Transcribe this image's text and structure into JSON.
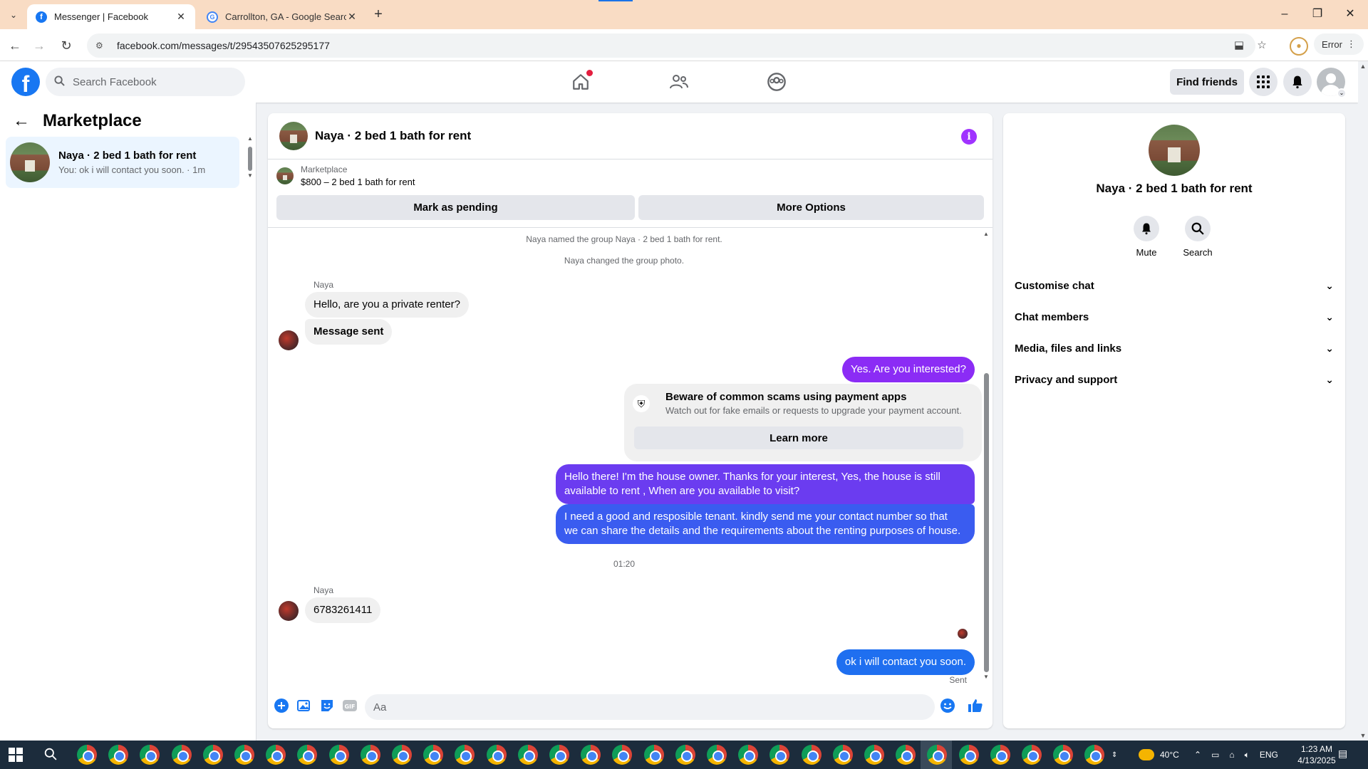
{
  "browser": {
    "tabs": [
      {
        "title": "Messenger | Facebook",
        "active": true
      },
      {
        "title": "Carrollton, GA - Google Search",
        "active": false
      }
    ],
    "url": "facebook.com/messages/t/29543507625295177",
    "error_label": "Error"
  },
  "fb": {
    "search_placeholder": "Search Facebook",
    "find_friends": "Find friends"
  },
  "sidebar": {
    "title": "Marketplace",
    "conversations": [
      {
        "name": "Naya · 2 bed 1 bath for rent",
        "preview": "You: ok i will contact you soon. · 1m"
      }
    ]
  },
  "chat": {
    "title": "Naya · 2 bed 1 bath for rent",
    "marketplace_label": "Marketplace",
    "listing": "$800 – 2 bed 1 bath for rent",
    "btn_pending": "Mark as pending",
    "btn_more": "More Options",
    "system_messages": [
      "Naya named the group Naya · 2 bed 1 bath for rent.",
      "Naya changed the group photo."
    ],
    "sender": "Naya",
    "msg_in_1": "Hello, are you a private renter?",
    "msg_in_2": "Message sent",
    "msg_out_1": "Yes. Are you interested?",
    "scam_title": "Beware of common scams using payment apps",
    "scam_sub": "Watch out for fake emails or requests to upgrade your payment account.",
    "scam_learn": "Learn more",
    "msg_out_2_line1": "Hello there! I'm the house owner. Thanks for your interest, Yes, the house is still",
    "msg_out_2_line2": "available to rent , When are you available to visit?",
    "msg_out_3_line1": "I need a good and resposible tenant.  kindly send me your contact number so that",
    "msg_out_3_line2": "we can share the details and the requirements about the renting purposes of house.",
    "time": "01:20",
    "sender2": "Naya",
    "msg_in_3": "6783261411",
    "msg_out_4": "ok i will contact you soon.",
    "sent_status": "Sent",
    "composer_placeholder": "Aa",
    "colors": {
      "purple": "#8b2cf5",
      "violet": "#6b3cf0",
      "blue": "#3a5cf0",
      "brand": "#1877f2"
    }
  },
  "info_panel": {
    "name": "Naya · 2 bed 1 bath for rent",
    "actions": [
      {
        "label": "Mute",
        "icon": "bell-icon"
      },
      {
        "label": "Search",
        "icon": "search-icon"
      }
    ],
    "sections": [
      "Customise chat",
      "Chat members",
      "Media, files and links",
      "Privacy and support"
    ]
  },
  "taskbar": {
    "temperature": "40°C",
    "lang": "ENG",
    "time": "1:23 AM",
    "date": "4/13/2025"
  }
}
